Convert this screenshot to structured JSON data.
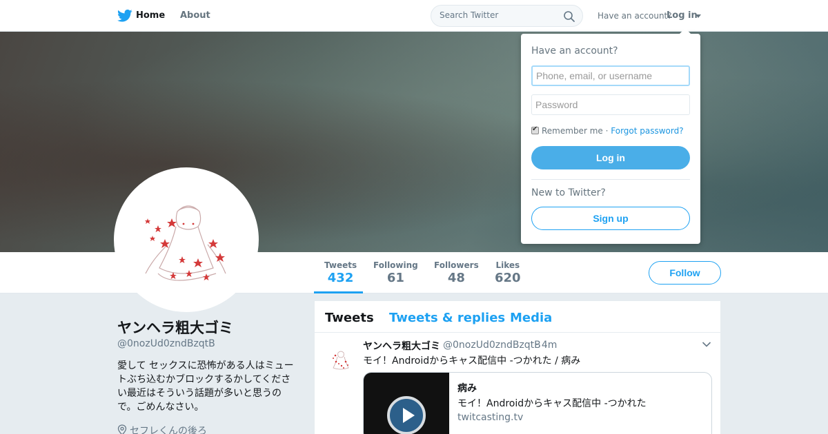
{
  "nav": {
    "home_label": "Home",
    "about_label": "About",
    "search_placeholder": "Search Twitter",
    "have_account": "Have an account?",
    "login_label": "Log in"
  },
  "profile": {
    "name": "ヤンヘラ粗大ゴミ",
    "handle": "@0nozUd0zndBzqtB",
    "bio": "愛して セックスに恐怖がある人はミュートぶち込むかブロックするかしてください最近はそういう話題が多いと思うので。ごめんなさい。",
    "location": "セフレくんの後ろ",
    "follow_label": "Follow",
    "stats": [
      {
        "label": "Tweets",
        "value": "432"
      },
      {
        "label": "Following",
        "value": "61"
      },
      {
        "label": "Followers",
        "value": "48"
      },
      {
        "label": "Likes",
        "value": "620"
      }
    ]
  },
  "timeline": {
    "tabs": [
      "Tweets",
      "Tweets & replies",
      "Media"
    ],
    "tweet": {
      "name": "ヤンヘラ粗大ゴミ",
      "handle": "@0nozUd0zndBzqtB",
      "time": "· 4m",
      "text": "モイ！Androidからキャス配信中 -つかれた / 病み",
      "card": {
        "title": "病み",
        "description": "モイ！Androidからキャス配信中 -つかれた",
        "domain": "twitcasting.tv"
      }
    }
  },
  "login_dropdown": {
    "title": "Have an account?",
    "username_placeholder": "Phone, email, or username",
    "password_placeholder": "Password",
    "remember_me": "Remember me",
    "separator": "·",
    "forgot_password": "Forgot password?",
    "login_button": "Log in",
    "new_to_twitter": "New to Twitter?",
    "signup_button": "Sign up"
  },
  "colors": {
    "accent": "#1da1f2",
    "login_button": "#4aaee8",
    "background": "#e6ecf0"
  },
  "icons": [
    "twitter-bird-icon",
    "search-icon",
    "chevron-down-icon",
    "location-pin-icon",
    "play-icon"
  ]
}
